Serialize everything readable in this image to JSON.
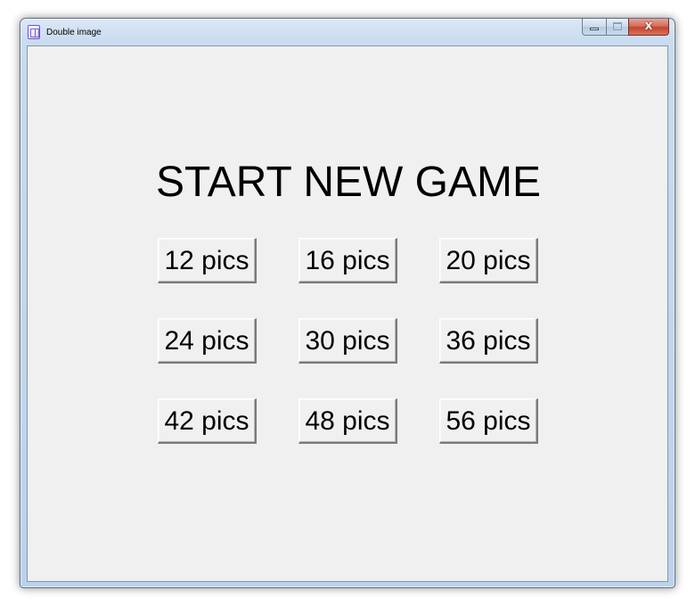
{
  "window": {
    "title": "Double image",
    "close_glyph": "X",
    "icons": {
      "app": "double-image-app-icon",
      "minimize": "minimize-icon",
      "maximize": "maximize-icon",
      "close": "close-icon"
    }
  },
  "main": {
    "heading": "START NEW GAME",
    "buttons": [
      {
        "label": "12 pics"
      },
      {
        "label": "16 pics"
      },
      {
        "label": "20 pics"
      },
      {
        "label": "24 pics"
      },
      {
        "label": "30 pics"
      },
      {
        "label": "36 pics"
      },
      {
        "label": "42 pics"
      },
      {
        "label": "48 pics"
      },
      {
        "label": "56 pics"
      }
    ]
  },
  "colors": {
    "client_background": "#f0f0f0",
    "close_button": "#c4452e",
    "text": "#000000"
  }
}
